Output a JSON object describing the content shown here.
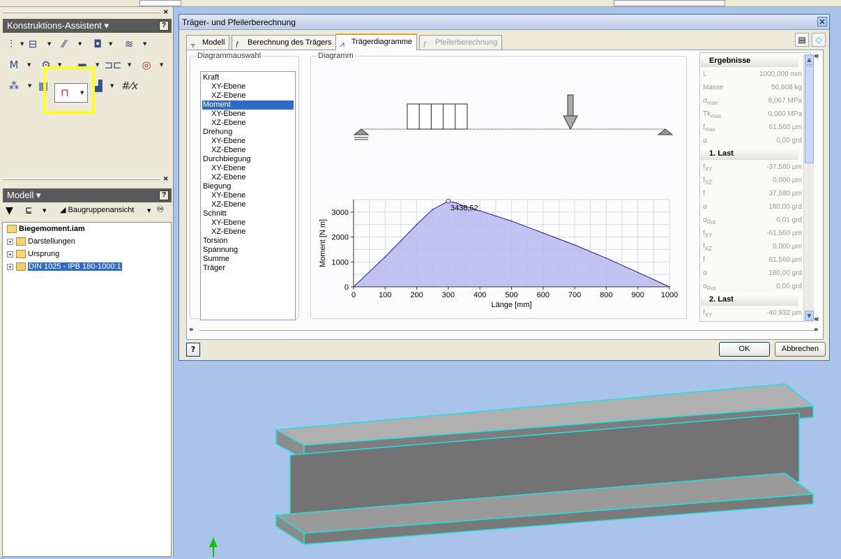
{
  "left_panel": {
    "assistant_title": "Konstruktions-Assistent",
    "model_title": "Modell",
    "model_view_label": "Baugruppenansicht",
    "tree": [
      {
        "label": "Biegemoment.iam",
        "bold": true
      },
      {
        "label": "Darstellungen"
      },
      {
        "label": "Ursprung"
      },
      {
        "label": "DIN 1025 - IPB 180-1000:1",
        "selected": true
      }
    ],
    "tool_icons": [
      "bolt-connection-icon",
      "shaft-icon",
      "gear-icon",
      "bearing-icon",
      "spring-icon",
      "key-icon",
      "cam-icon",
      "belt-icon",
      "chain-icon",
      "clevis-icon",
      "beam-icon",
      "column-icon",
      "calculator-icon",
      "formula-icon"
    ]
  },
  "dialog": {
    "title": "Träger- und Pfeilerberechnung",
    "tabs": [
      {
        "label": "Modell",
        "icon": "beam-model-icon"
      },
      {
        "label": "Berechnung des Trägers",
        "icon": "function-icon"
      },
      {
        "label": "Trägerdiagramme",
        "icon": "diagram-icon",
        "active": true
      },
      {
        "label": "Pfeilerberechnung",
        "icon": "column-calc-icon",
        "disabled": true
      }
    ],
    "group_select_title": "Diagrammauswahl",
    "group_diagram_title": "Diagramm",
    "diagram_list": [
      {
        "label": "Kraft"
      },
      {
        "label": "XY-Ebene",
        "sub": true
      },
      {
        "label": "XZ-Ebene",
        "sub": true
      },
      {
        "label": "Moment",
        "selected": true
      },
      {
        "label": "XY-Ebene",
        "sub": true
      },
      {
        "label": "XZ-Ebene",
        "sub": true
      },
      {
        "label": "Drehung"
      },
      {
        "label": "XY-Ebene",
        "sub": true
      },
      {
        "label": "XZ-Ebene",
        "sub": true
      },
      {
        "label": "Durchbiegung"
      },
      {
        "label": "XY-Ebene",
        "sub": true
      },
      {
        "label": "XZ-Ebene",
        "sub": true
      },
      {
        "label": "Biegung"
      },
      {
        "label": "XY-Ebene",
        "sub": true
      },
      {
        "label": "XZ-Ebene",
        "sub": true
      },
      {
        "label": "Schnitt"
      },
      {
        "label": "XY-Ebene",
        "sub": true
      },
      {
        "label": "XZ-Ebene",
        "sub": true
      },
      {
        "label": "Torsion"
      },
      {
        "label": "Spannung"
      },
      {
        "label": "Summe"
      },
      {
        "label": "Träger"
      }
    ],
    "results": {
      "header": "Ergebnisse",
      "rows_main": [
        {
          "label": "L",
          "value": "1000,000 mm"
        },
        {
          "label": "Masse",
          "value": "50,608 kg"
        },
        {
          "label": "σ",
          "sub": "max",
          "value": "8,067 MPa"
        },
        {
          "label": "Tk",
          "sub": "max",
          "value": "0,000 MPa"
        },
        {
          "label": "f",
          "sub": "max",
          "value": "61,560 µm"
        },
        {
          "label": "α",
          "value": "0,00 grd"
        }
      ],
      "last1_header": "1. Last",
      "rows_last1": [
        {
          "label": "f",
          "sub": "XY",
          "value": "-37,580 µm"
        },
        {
          "label": "f",
          "sub": "XZ",
          "value": "0,000 µm"
        },
        {
          "label": "f",
          "value": "37,580 µm"
        },
        {
          "label": "α",
          "value": "180,00 grd"
        },
        {
          "label": "α",
          "sub": "Rot",
          "value": "0,01 grd"
        },
        {
          "label": "f",
          "sub": "XY",
          "value": "-61,560 µm"
        },
        {
          "label": "f",
          "sub": "XZ",
          "value": "0,000 µm"
        },
        {
          "label": "f",
          "value": "61,560 µm"
        },
        {
          "label": "α",
          "value": "180,00 grd"
        },
        {
          "label": "α",
          "sub": "Rot",
          "value": "0,00 grd"
        }
      ],
      "last2_header": "2. Last",
      "rows_last2": [
        {
          "label": "f",
          "sub": "XY",
          "value": "-40,932 µm"
        }
      ]
    },
    "ok_label": "OK",
    "cancel_label": "Abbrechen",
    "help_label": "?"
  },
  "chart_data": {
    "type": "area",
    "xlabel": "Länge [mm]",
    "ylabel": "Moment [N m]",
    "xlim": [
      0,
      1000
    ],
    "ylim": [
      0,
      3500
    ],
    "xticks": [
      0,
      100,
      200,
      300,
      400,
      500,
      600,
      700,
      800,
      900,
      1000
    ],
    "yticks": [
      0,
      1000,
      2000,
      3000
    ],
    "x": [
      0,
      100,
      200,
      250,
      300,
      325,
      350,
      400,
      500,
      600,
      700,
      800,
      900,
      1000
    ],
    "values": [
      0,
      1200,
      2500,
      3100,
      3436.52,
      3370,
      3240,
      3050,
      2640,
      2160,
      1680,
      1150,
      580,
      0
    ],
    "annotation": {
      "x": 300,
      "y": 3436.52,
      "text": "3436,52"
    },
    "grid": true,
    "colors": {
      "fill": "#b7b8f0",
      "line": "#1c1c8c"
    }
  },
  "colors": {
    "accent": "#316ac5",
    "highlight": "#ffff1a",
    "viewport": "#a9c3ea",
    "beam_edge": "#20e0e0"
  }
}
